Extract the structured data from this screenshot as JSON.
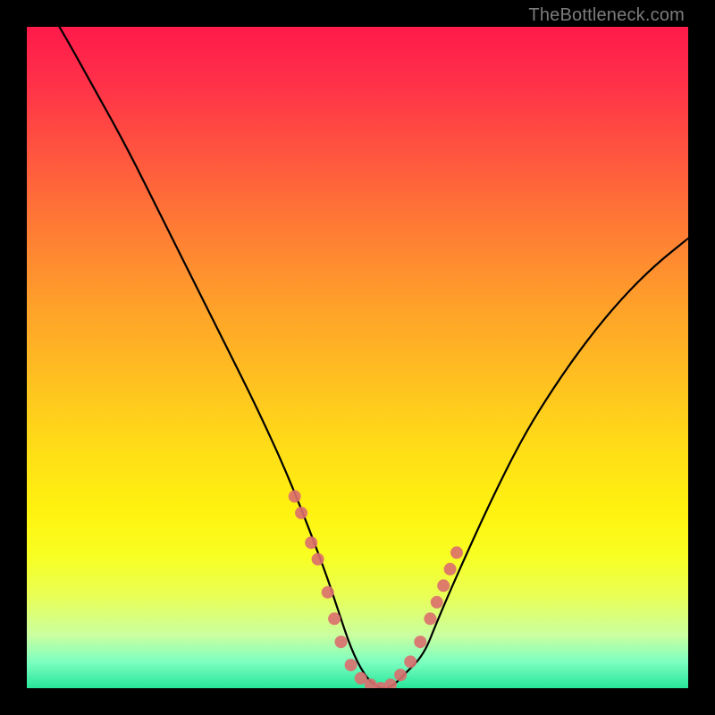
{
  "watermark": "TheBottleneck.com",
  "chart_data": {
    "type": "line",
    "title": "",
    "xlabel": "",
    "ylabel": "",
    "xlim": [
      0,
      100
    ],
    "ylim": [
      0,
      100
    ],
    "x": [
      0,
      5,
      10,
      15,
      20,
      25,
      30,
      35,
      40,
      45,
      47,
      49,
      51,
      53,
      55,
      57,
      60,
      62,
      65,
      70,
      75,
      80,
      85,
      90,
      95,
      100
    ],
    "values": [
      108,
      100,
      91,
      82,
      72,
      62,
      52,
      42,
      31,
      18,
      12,
      6,
      2,
      0,
      0,
      2,
      5,
      10,
      17,
      28,
      38,
      46,
      53,
      59,
      64,
      68
    ],
    "highlight_x": [
      40.5,
      41.5,
      43.0,
      44.0,
      45.5,
      46.5,
      47.5,
      49.0,
      50.5,
      52.0,
      53.5,
      55.0,
      56.5,
      58.0,
      59.5,
      61.0,
      62.0,
      63.0,
      64.0,
      65.0
    ],
    "highlight_values": [
      29.0,
      26.5,
      22.0,
      19.5,
      14.5,
      10.5,
      7.0,
      3.5,
      1.5,
      0.5,
      0.0,
      0.5,
      2.0,
      4.0,
      7.0,
      10.5,
      13.0,
      15.5,
      18.0,
      20.5
    ]
  }
}
